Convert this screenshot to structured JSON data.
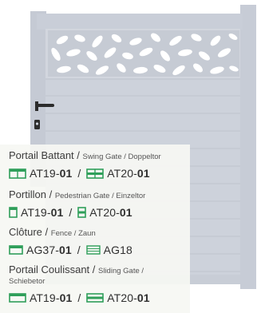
{
  "colors": {
    "gate_frame": "#c4c9d3",
    "gate_panel": "#cfd3dc",
    "leaf_cutout": "#ffffff",
    "panel_bg": "#f6f8f3",
    "icon_green": "#2f9f5a",
    "text": "#3a3a3a"
  },
  "gate_icons": [
    "door-handle-icon",
    "keyhole-icon",
    "leaf-pattern-icon"
  ],
  "products": [
    {
      "title": "Portail Battant",
      "subtitle": "Swing Gate / Doppeltor",
      "codes": [
        {
          "icon": "swing-gate-icon",
          "prefix": "AT19-",
          "suffix": "01"
        },
        {
          "icon": "swing-gate-split-icon",
          "prefix": "AT20-",
          "suffix": "01"
        }
      ]
    },
    {
      "title": "Portillon",
      "subtitle": "Pedestrian Gate / Einzeltor",
      "codes": [
        {
          "icon": "pedestrian-gate-icon",
          "prefix": "AT19-",
          "suffix": "01"
        },
        {
          "icon": "pedestrian-gate-split-icon",
          "prefix": "AT20-",
          "suffix": "01"
        }
      ]
    },
    {
      "title": "Clôture",
      "subtitle": "Fence / Zaun",
      "codes": [
        {
          "icon": "fence-icon",
          "prefix": "AG37-",
          "suffix": "01"
        },
        {
          "icon": "fence-slats-icon",
          "prefix": "AG18",
          "suffix": ""
        }
      ]
    },
    {
      "title": "Portail Coulissant",
      "subtitle": "Sliding Gate /",
      "subtitle_line2": "Schiebetor",
      "codes": [
        {
          "icon": "sliding-gate-icon",
          "prefix": "AT19-",
          "suffix": "01"
        },
        {
          "icon": "sliding-gate-split-icon",
          "prefix": "AT20-",
          "suffix": "01"
        }
      ]
    }
  ],
  "separator": "/"
}
